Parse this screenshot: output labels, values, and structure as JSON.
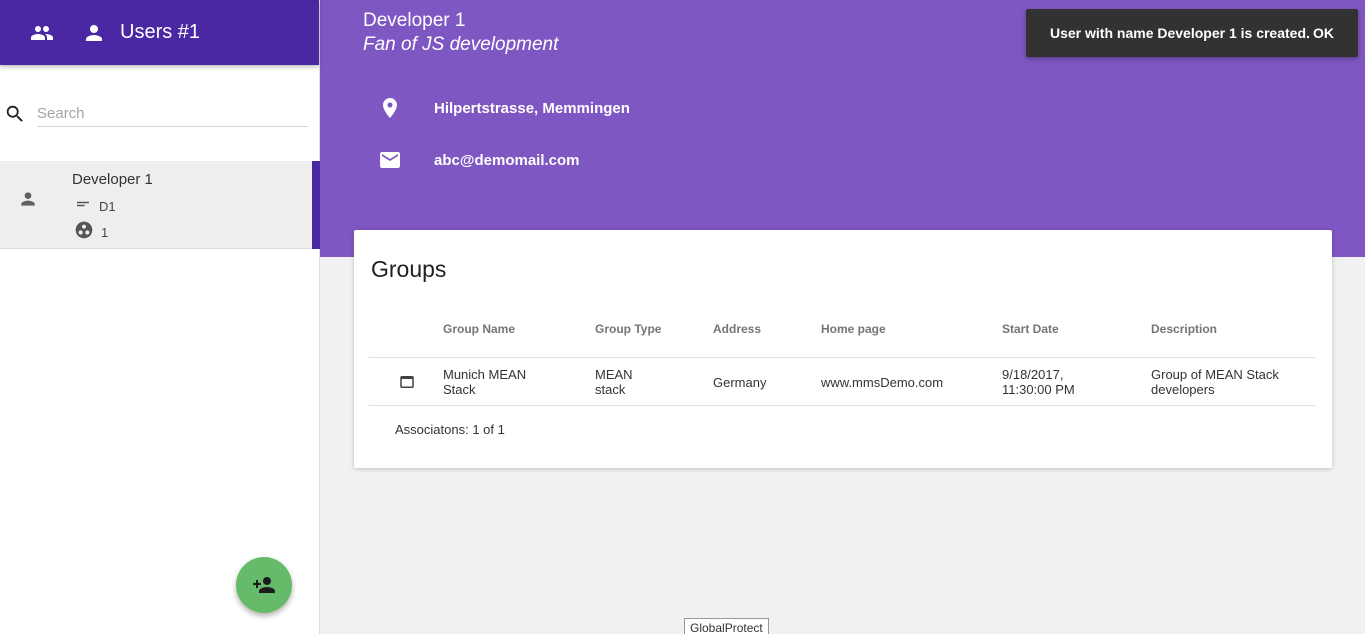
{
  "sidebar": {
    "header_title": "Users #1",
    "header_icons": [
      "group-icon",
      "person-icon"
    ],
    "search": {
      "placeholder": "Search",
      "value": ""
    },
    "users": [
      {
        "name": "Developer 1",
        "short_name": "D1",
        "group_count": "1",
        "icon": "person-icon"
      }
    ],
    "fab_icon": "person-add-icon"
  },
  "banner": {
    "name": "Developer 1",
    "tagline": "Fan of JS development",
    "address": "Hilpertstrasse, Memmingen",
    "email": "abc@demomail.com",
    "color": "#7e57c2"
  },
  "snackbar": {
    "message": "User with name Developer 1 is created.",
    "action": "OK"
  },
  "groups": {
    "title": "Groups",
    "columns": [
      "Group Name",
      "Group Type",
      "Address",
      "Home page",
      "Start Date",
      "Description"
    ],
    "rows": [
      {
        "name": [
          "Munich MEAN",
          "Stack"
        ],
        "type": [
          "MEAN",
          "stack"
        ],
        "address": "Germany",
        "homepage": "www.mmsDemo.com",
        "start_date": [
          "9/18/2017,",
          "11:30:00 PM"
        ],
        "description": [
          "Group of MEAN Stack",
          "developers"
        ]
      }
    ],
    "footer": "Associatons: 1 of 1"
  },
  "taskbar_tag": "GlobalProtect",
  "colors": {
    "header": "#4a28a4",
    "banner": "#7e57c2",
    "fab": "#66bb6a",
    "snackbar": "#323232"
  }
}
